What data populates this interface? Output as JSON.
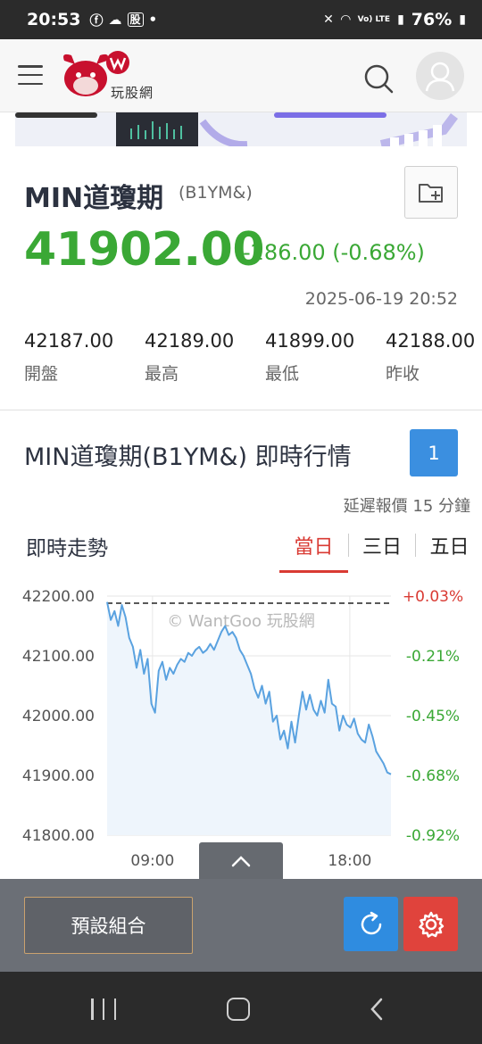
{
  "status_bar": {
    "time": "20:53",
    "app_badge": "股",
    "signal_text": "Vo) LTE",
    "battery": "76%"
  },
  "header": {
    "logo_text": "玩股網",
    "search_icon": "search-icon",
    "menu_icon": "hamburger-icon",
    "avatar_icon": "user-icon"
  },
  "quote": {
    "name": "MIN道瓊期",
    "code": "(B1YM&)",
    "price": "41902.00",
    "change": "-286.00 (-0.68%)",
    "timestamp": "2025-06-19 20:52",
    "price_color": "#3aa835",
    "stats": [
      {
        "value": "42187.00",
        "label": "開盤"
      },
      {
        "value": "42189.00",
        "label": "最高"
      },
      {
        "value": "41899.00",
        "label": "最低"
      },
      {
        "value": "42188.00",
        "label": "昨收"
      }
    ]
  },
  "live": {
    "title": "MIN道瓊期(B1YM&) 即時行情",
    "count": "1",
    "delay_note": "延遲報價 15 分鐘",
    "trend_label": "即時走勢",
    "tabs": [
      "當日",
      "三日",
      "五日"
    ],
    "active_tab": "當日"
  },
  "chart_data": {
    "type": "line",
    "title": "",
    "watermark": "© WantGoo 玩股網",
    "y_ticks": [
      "42200.00",
      "42100.00",
      "42000.00",
      "41900.00",
      "41800.00"
    ],
    "y_right_ticks": [
      "+0.03%",
      "-0.21%",
      "-0.45%",
      "-0.68%",
      "-0.92%"
    ],
    "x_ticks": [
      "09:00",
      "18:00"
    ],
    "ylim": [
      41800,
      42200
    ],
    "reference_value": 42188,
    "line_color": "#5aa2e0",
    "fill_color": "#eef5fc",
    "up_color": "#d93a33",
    "down_color": "#3aa835",
    "series": [
      {
        "x": [
          0,
          1,
          2,
          3,
          4,
          5,
          6,
          7,
          8,
          9,
          10,
          11,
          12,
          13,
          14,
          15,
          16,
          17,
          18,
          19,
          20,
          21,
          22,
          23,
          24,
          25,
          26,
          27,
          28,
          29,
          30,
          31,
          32,
          33,
          34,
          35,
          36,
          37,
          38,
          39,
          40,
          41,
          42,
          43,
          44,
          45,
          46,
          47,
          48,
          49,
          50,
          51,
          52,
          53,
          54,
          55,
          56,
          57,
          58,
          59,
          60,
          61,
          62,
          63,
          64,
          65,
          66,
          67,
          68,
          69,
          70,
          71,
          72,
          73,
          74,
          75,
          76,
          77
        ],
        "y": [
          42190,
          42160,
          42175,
          42150,
          42185,
          42165,
          42130,
          42115,
          42080,
          42110,
          42070,
          42095,
          42020,
          42005,
          42075,
          42090,
          42060,
          42080,
          42070,
          42085,
          42095,
          42090,
          42105,
          42100,
          42110,
          42115,
          42105,
          42110,
          42120,
          42110,
          42125,
          42140,
          42150,
          42135,
          42140,
          42130,
          42110,
          42100,
          42085,
          42070,
          42045,
          42030,
          42050,
          42020,
          42040,
          41990,
          42000,
          41960,
          41975,
          41945,
          41990,
          41955,
          42000,
          42040,
          42010,
          42035,
          42010,
          42000,
          42025,
          42005,
          42060,
          42020,
          42015,
          41975,
          42000,
          41985,
          41980,
          41995,
          41970,
          41960,
          41955,
          41985,
          41965,
          41940,
          41930,
          41920,
          41905,
          41902
        ]
      }
    ]
  },
  "toolbar": {
    "preset_label": "預設組合",
    "refresh_icon": "refresh-icon",
    "settings_icon": "gear-icon",
    "collapse_icon": "chevron-up-icon"
  },
  "colors": {
    "accent_blue": "#3b8fe0",
    "accent_red": "#e0433c",
    "toolbar_bg": "#6b6f76"
  }
}
